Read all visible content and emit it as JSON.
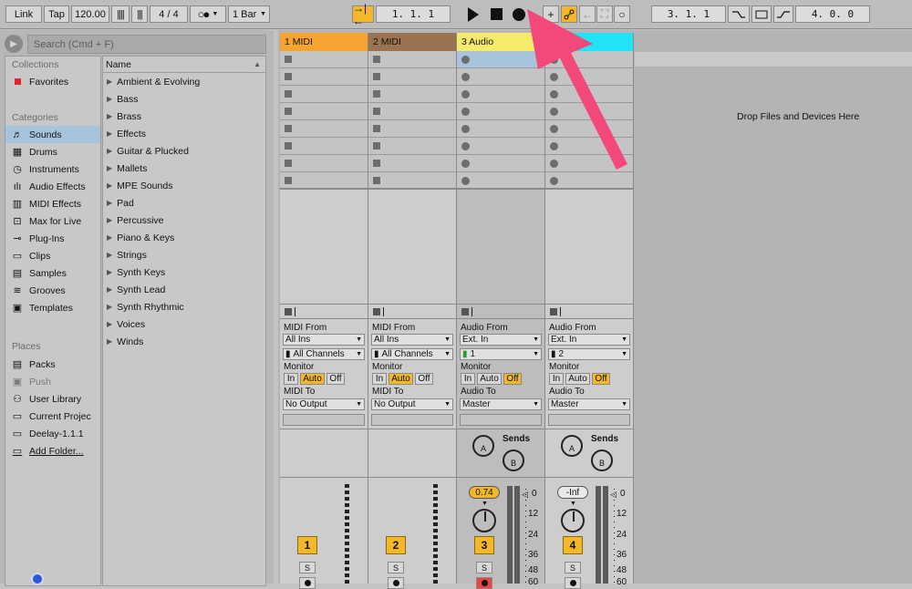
{
  "transport": {
    "link": "Link",
    "tap": "Tap",
    "tempo": "120.00",
    "signature_num": "4",
    "signature_sep": "/",
    "signature_den": "4",
    "quantize": "1 Bar",
    "position": "1.  1.  1",
    "loop_start": "3.  1.  1",
    "loop_length": "4.  0.  0"
  },
  "browser": {
    "search_placeholder": "Search (Cmd + F)",
    "collections_label": "Collections",
    "favorites": "Favorites",
    "categories_label": "Categories",
    "categories": [
      "Sounds",
      "Drums",
      "Instruments",
      "Audio Effects",
      "MIDI Effects",
      "Max for Live",
      "Plug-Ins",
      "Clips",
      "Samples",
      "Grooves",
      "Templates"
    ],
    "places_label": "Places",
    "places": [
      "Packs",
      "Push",
      "User Library",
      "Current Projec",
      "Deelay-1.1.1",
      "Add Folder..."
    ],
    "name_header": "Name",
    "names": [
      "Ambient & Evolving",
      "Bass",
      "Brass",
      "Effects",
      "Guitar & Plucked",
      "Mallets",
      "MPE Sounds",
      "Pad",
      "Percussive",
      "Piano & Keys",
      "Strings",
      "Synth Keys",
      "Synth Lead",
      "Synth Rhythmic",
      "Voices",
      "Winds"
    ]
  },
  "session": {
    "drop_text": "Drop Files and Devices Here",
    "tracks": [
      {
        "name": "1 MIDI",
        "color": "#f5a431",
        "from_label": "MIDI From",
        "from": "All Ins",
        "channel": "All Channels",
        "monitor_label": "Monitor",
        "mon_in": "In",
        "mon_auto": "Auto",
        "mon_off": "Off",
        "to_label": "MIDI To",
        "to": "No Output",
        "number": "1",
        "solo": "S"
      },
      {
        "name": "2 MIDI",
        "color": "#9b7350",
        "from_label": "MIDI From",
        "from": "All Ins",
        "channel": "All Channels",
        "monitor_label": "Monitor",
        "mon_in": "In",
        "mon_auto": "Auto",
        "mon_off": "Off",
        "to_label": "MIDI To",
        "to": "No Output",
        "number": "2",
        "solo": "S"
      },
      {
        "name": "3 Audio",
        "color": "#f4ea6c",
        "from_label": "Audio From",
        "from": "Ext. In",
        "channel": "1",
        "monitor_label": "Monitor",
        "mon_in": "In",
        "mon_auto": "Auto",
        "mon_off": "Off",
        "to_label": "Audio To",
        "to": "Master",
        "number": "3",
        "solo": "S",
        "volume": "0.74",
        "sends": "Sends",
        "send_a": "A",
        "send_b": "B"
      },
      {
        "name": "Audio",
        "color": "#22e3f5",
        "from_label": "Audio From",
        "from": "Ext. In",
        "channel": "2",
        "monitor_label": "Monitor",
        "mon_in": "In",
        "mon_auto": "Auto",
        "mon_off": "Off",
        "to_label": "Audio To",
        "to": "Master",
        "number": "4",
        "solo": "S",
        "volume": "-Inf",
        "sends": "Sends",
        "send_a": "A",
        "send_b": "B"
      }
    ],
    "db_ticks": [
      "0",
      "12",
      "24",
      "36",
      "48",
      "60"
    ]
  },
  "colors": {
    "accent": "#f3b72a",
    "annotation_arrow": "#f2487a"
  }
}
